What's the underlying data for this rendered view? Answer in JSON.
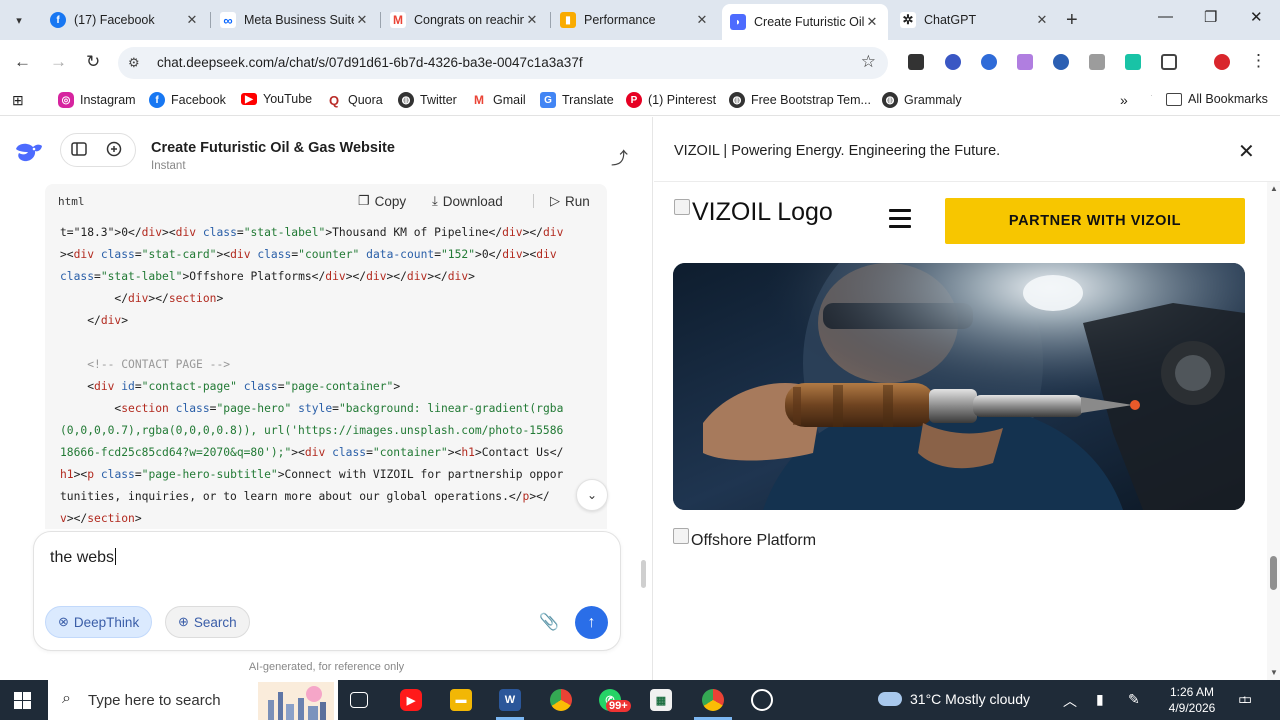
{
  "browser": {
    "tabs": [
      {
        "title": "(17) Facebook",
        "icon": "facebook-icon",
        "color": "#1877f2",
        "active": false
      },
      {
        "title": "Meta Business Suite",
        "icon": "meta-icon",
        "color": "#0866ff",
        "active": false
      },
      {
        "title": "Congrats on reaching",
        "icon": "gmail-icon",
        "color": "#ea4335",
        "active": false
      },
      {
        "title": "Performance",
        "icon": "analytics-icon",
        "color": "#f9ab00",
        "active": false
      },
      {
        "title": "Create Futuristic Oil",
        "icon": "deepseek-icon",
        "color": "#4d6bfe",
        "active": true
      },
      {
        "title": "ChatGPT",
        "icon": "chatgpt-icon",
        "color": "#222222",
        "active": false
      }
    ],
    "url": "chat.deepseek.com/a/chat/s/07d91d61-6b7d-4326-ba3e-0047c1a3a37f",
    "bookmarks": [
      {
        "label": "Instagram",
        "icon": "instagram-icon",
        "color": "#d6249f"
      },
      {
        "label": "Facebook",
        "icon": "facebook-icon",
        "color": "#1877f2"
      },
      {
        "label": "YouTube",
        "icon": "youtube-icon",
        "color": "#ff0000"
      },
      {
        "label": "Quora",
        "icon": "quora-icon",
        "color": "#b92b27"
      },
      {
        "label": "Twitter",
        "icon": "globe-icon",
        "color": "#333333"
      },
      {
        "label": "Gmail",
        "icon": "gmail-icon",
        "color": "#ea4335"
      },
      {
        "label": "Translate",
        "icon": "translate-icon",
        "color": "#4285f4"
      },
      {
        "label": "(1) Pinterest",
        "icon": "pinterest-icon",
        "color": "#e60023"
      },
      {
        "label": "Free Bootstrap Tem...",
        "icon": "globe-icon",
        "color": "#333333"
      },
      {
        "label": "Grammaly",
        "icon": "globe-icon",
        "color": "#333333"
      }
    ],
    "all_bookmarks": "All Bookmarks"
  },
  "chat": {
    "title": "Create Futuristic Oil & Gas Website",
    "model": "Instant",
    "code": {
      "lang": "html",
      "copy": "Copy",
      "download": "Download",
      "run": "Run"
    },
    "input_text": "the webs",
    "deepthink": "DeepThink",
    "search": "Search",
    "disclaimer": "AI-generated, for reference only"
  },
  "preview": {
    "title": "VIZOIL | Powering Energy. Engineering the Future.",
    "logo_alt": "VIZOIL Logo",
    "partner_button": "PARTNER WITH VIZOIL",
    "image_alt": "Offshore Platform"
  },
  "taskbar": {
    "search_placeholder": "Type here to search",
    "whatsapp_badge": "99+",
    "weather": "31°C  Mostly cloudy",
    "time": "1:26 AM",
    "date": "4/9/2026",
    "notification_count": "1"
  }
}
